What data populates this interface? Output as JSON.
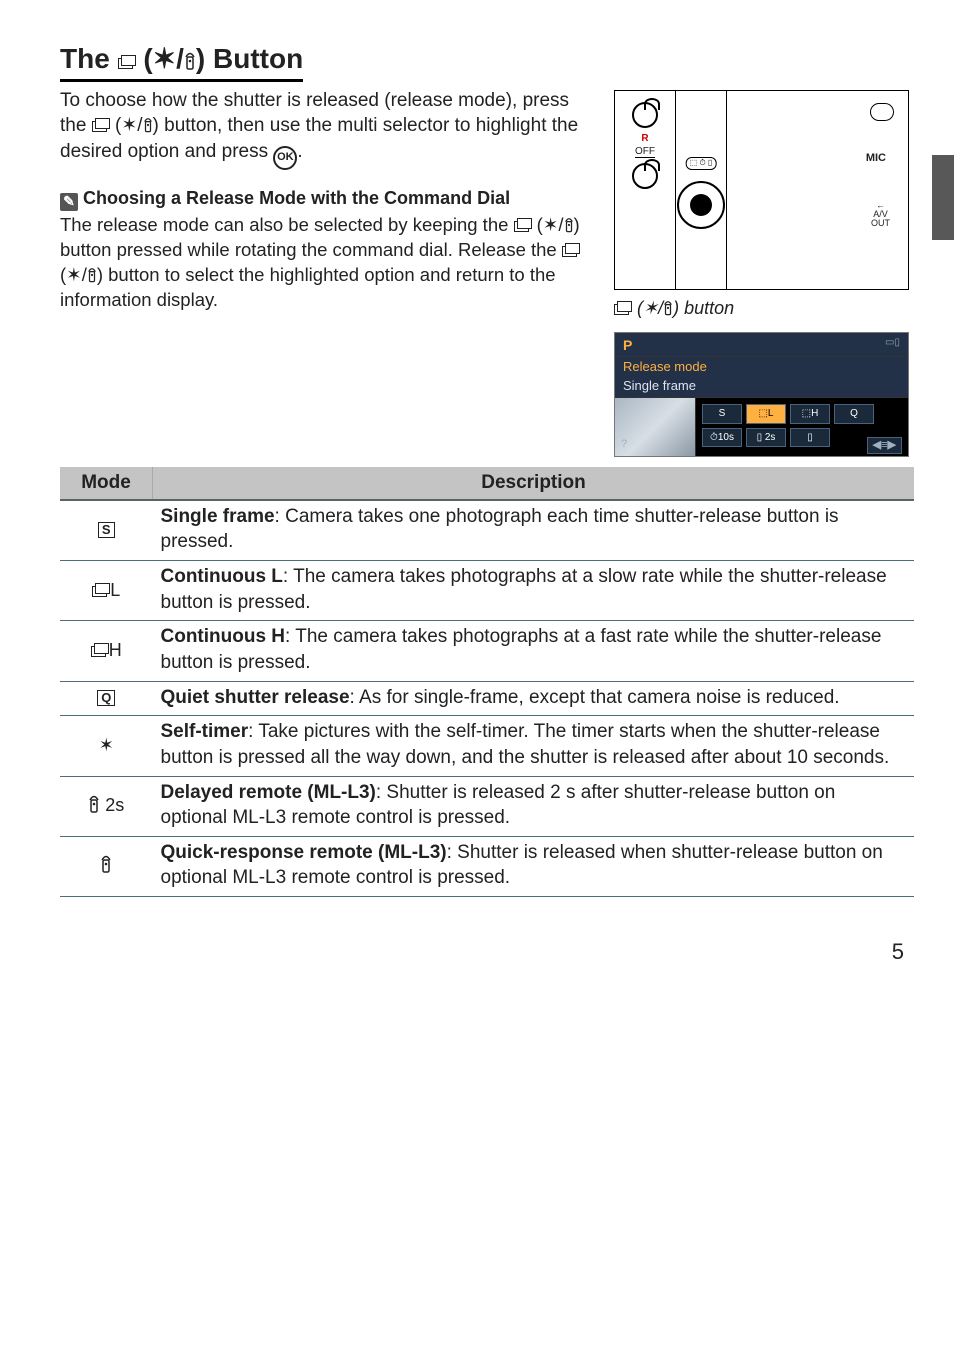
{
  "title_prefix": "The ",
  "title_suffix": " Button",
  "intro": "To choose how the shutter is released (release mode), press the ⬚ (⏱/▯) button, then use the multi selector to highlight the desired option and press ",
  "intro_end": ".",
  "ok_label": "OK",
  "note_title": "Choosing a Release Mode with the Command Dial",
  "note_body": "The release mode can also be selected by keeping the ⬚ (⏱/▯) button pressed while rotating the command dial.  Release the ⬚ (⏱/▯) button to select the highlighted option and return to the information display.",
  "diagram_caption_prefix": "⬚ (⏱/▯) ",
  "diagram_caption_word": "button",
  "diagram": {
    "roff_r": "R",
    "roff_off": "OFF",
    "mic": "MIC",
    "av": "A/V OUT",
    "shutter_lbl": "⬚ ⏱ ▯"
  },
  "screen": {
    "p": "P",
    "title": "Release mode",
    "subtitle": "Single frame",
    "row1": [
      "S",
      "⬚L",
      "⬚H",
      "Q"
    ],
    "row2": [
      "⏱10s",
      "▯ 2s",
      "▯"
    ],
    "help": "?",
    "foot": "◀≡▶"
  },
  "table": {
    "headers": [
      "Mode",
      "Description"
    ],
    "rows": [
      {
        "mode_icon": "S-box",
        "bold": "Single frame",
        "text": ": Camera takes one photograph each time shutter-release button is pressed."
      },
      {
        "mode_icon": "stack-L",
        "bold": "Continuous L",
        "text": ": The camera takes photographs at a slow rate while the shutter-release button is pressed."
      },
      {
        "mode_icon": "stack-H",
        "bold": "Continuous H",
        "text": ": The camera takes photographs at a fast rate while the shutter-release button is pressed."
      },
      {
        "mode_icon": "Q-box",
        "bold": "Quiet shutter release",
        "text": ": As for single-frame, except that camera noise is reduced."
      },
      {
        "mode_icon": "timer",
        "bold": "Self-timer",
        "text": ": Take pictures with the self-timer. The timer starts when the shutter-release button is pressed all the way down, and the shutter is released after about 10 seconds."
      },
      {
        "mode_icon": "remote-2s",
        "bold": "Delayed remote (ML-L3)",
        "text": ": Shutter is released 2 s after shutter-release button on optional ML-L3 remote control is pressed."
      },
      {
        "mode_icon": "remote",
        "bold": "Quick-response remote (ML-L3)",
        "text": ": Shutter is released when shutter-release button on optional ML-L3 remote control is pressed."
      }
    ]
  },
  "page_number": "5"
}
